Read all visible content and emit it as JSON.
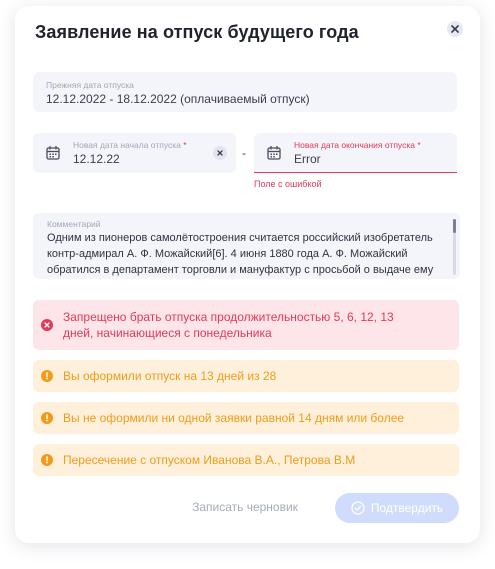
{
  "dialog": {
    "title": "Заявление на отпуск будущего года"
  },
  "previous": {
    "label": "Прежняя дата отпуска",
    "value": "12.12.2022 - 18.12.2022 (оплачиваемый отпуск)"
  },
  "start_date": {
    "label": "Новая дата начала отпуска",
    "required_mark": "*",
    "value": "12.12.22"
  },
  "separator": "-",
  "end_date": {
    "label": "Новая дата окончания отпуска",
    "required_mark": "*",
    "value": "Error",
    "error_text": "Поле с ошибкой"
  },
  "comment": {
    "label": "Комментарий",
    "value": "Одним из пионеров самолётостроения считается российский изобретатель контр-адмирал А. Ф. Можайский[6]. 4 июня 1880 года А. Ф. Можайский обратился в департамент торговли и мануфактур с просьбой о выдаче ему"
  },
  "alerts": [
    {
      "type": "error",
      "text": "Запрещено брать отпуска продолжительностью 5, 6, 12, 13 дней, начинающиеся с понедельника"
    },
    {
      "type": "warning",
      "text": "Вы оформили отпуск на 13 дней из 28"
    },
    {
      "type": "warning",
      "text": "Вы не оформили ни одной заявки равной 14 дням или более"
    },
    {
      "type": "warning",
      "text": "Пересечение с отпуском Иванова В.А., Петрова В.М"
    }
  ],
  "actions": {
    "draft_label": "Записать черновик",
    "confirm_label": "Подтвердить"
  },
  "colors": {
    "error": "#e03b56",
    "warning": "#ef9c1a",
    "accent_disabled": "#cfdcfb"
  }
}
